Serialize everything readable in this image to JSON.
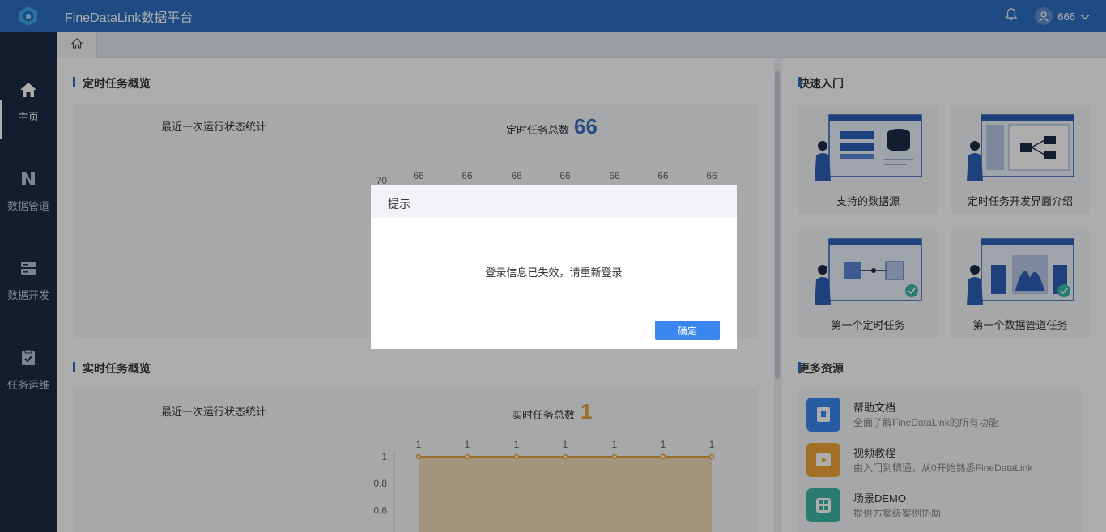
{
  "app": {
    "title": "FineDataLink数据平台"
  },
  "header": {
    "username": "666"
  },
  "sidebar": {
    "items": [
      {
        "label": "主页",
        "icon": "home-icon"
      },
      {
        "label": "数据管道",
        "icon": "pipeline-icon"
      },
      {
        "label": "数据开发",
        "icon": "server-icon"
      },
      {
        "label": "任务运维",
        "icon": "clipboard-check-icon"
      }
    ]
  },
  "scheduled": {
    "title": "定时任务概览",
    "sub_title": "最近一次运行状态统计",
    "total_label": "定时任务总数",
    "total_value": "66",
    "color": "#3b6fc6"
  },
  "realtime": {
    "title": "实时任务概览",
    "sub_title": "最近一次运行状态统计",
    "total_label": "实时任务总数",
    "total_value": "1",
    "color": "#e0a23b"
  },
  "chart_data": [
    {
      "type": "line",
      "series": [
        {
          "values": [
            66,
            66,
            66,
            66,
            66,
            66,
            66
          ]
        }
      ],
      "y_ticks": [
        "70"
      ],
      "data_labels": [
        "66",
        "66",
        "66",
        "66",
        "66",
        "66",
        "66"
      ]
    },
    {
      "type": "area",
      "series": [
        {
          "values": [
            1,
            1,
            1,
            1,
            1,
            1,
            1
          ]
        }
      ],
      "y_ticks": [
        "1",
        "0.8",
        "0.6"
      ],
      "data_labels": [
        "1",
        "1",
        "1",
        "1",
        "1",
        "1",
        "1"
      ],
      "color": "#e0a23b"
    }
  ],
  "quick_start": {
    "title": "快速入门",
    "cards": [
      {
        "label": "支持的数据源"
      },
      {
        "label": "定时任务开发界面介绍"
      },
      {
        "label": "第一个定时任务"
      },
      {
        "label": "第一个数据管道任务"
      }
    ]
  },
  "resources": {
    "title": "更多资源",
    "items": [
      {
        "title": "帮助文档",
        "desc": "全面了解FineDataLink的所有功能",
        "icon": "document-icon",
        "color": "#3a86f0"
      },
      {
        "title": "视频教程",
        "desc": "由入门到精通，从0开始熟悉FineDataLink",
        "icon": "video-icon",
        "color": "#f0a43a"
      },
      {
        "title": "场景DEMO",
        "desc": "提供方案级案例协助",
        "icon": "grid-icon",
        "color": "#3fb6a8"
      }
    ]
  },
  "dialog": {
    "title": "提示",
    "message": "登录信息已失效，请重新登录",
    "ok_label": "确定"
  }
}
